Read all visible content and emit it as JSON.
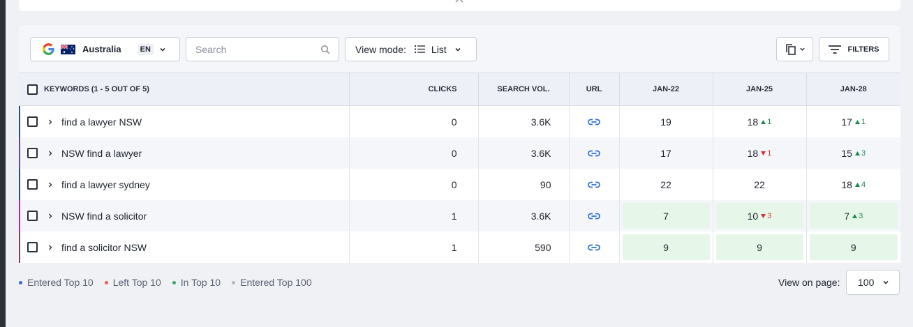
{
  "toolbar": {
    "country": "Australia",
    "language": "EN",
    "search_placeholder": "Search",
    "view_mode_label": "View mode:",
    "view_mode_value": "List",
    "filters_label": "FILTERS"
  },
  "table": {
    "headers": {
      "keywords": "KEYWORDS (1 - 5 OUT OF 5)",
      "clicks": "CLICKS",
      "search_vol": "SEARCH VOL.",
      "url": "URL",
      "d1": "JAN-22",
      "d2": "JAN-25",
      "d3": "JAN-28"
    },
    "rows": [
      {
        "keyword": "find a lawyer NSW",
        "clicks": "0",
        "volume": "3.6K",
        "d1": "19",
        "d2": "18",
        "d2_delta": "1",
        "d3": "17",
        "d3_delta": "1"
      },
      {
        "keyword": "NSW find a lawyer",
        "clicks": "0",
        "volume": "3.6K",
        "d1": "17",
        "d2": "18",
        "d2_delta": "1",
        "d3": "15",
        "d3_delta": "3"
      },
      {
        "keyword": "find a lawyer sydney",
        "clicks": "0",
        "volume": "90",
        "d1": "22",
        "d2": "22",
        "d2_delta": "",
        "d3": "18",
        "d3_delta": "4"
      },
      {
        "keyword": "NSW find a solicitor",
        "clicks": "1",
        "volume": "3.6K",
        "d1": "7",
        "d2": "10",
        "d2_delta": "3",
        "d3": "7",
        "d3_delta": "3"
      },
      {
        "keyword": "find a solicitor NSW",
        "clicks": "1",
        "volume": "590",
        "d1": "9",
        "d2": "9",
        "d2_delta": "",
        "d3": "9",
        "d3_delta": ""
      }
    ]
  },
  "legend": {
    "entered_top10": "Entered Top 10",
    "left_top10": "Left Top 10",
    "in_top10": "In Top 10",
    "entered_top100": "Entered Top 100"
  },
  "pagination": {
    "label": "View on page:",
    "value": "100"
  },
  "colors": {
    "row_bar_1": "#1f4e79",
    "row_bar_2": "#6b3fa0",
    "row_bar_3": "#1f4e79",
    "row_bar_4": "#d6189a",
    "row_bar_5": "#8b3a62",
    "up": "#1d8a4a",
    "down": "#d93036",
    "link": "#2d6fd6",
    "in_top10_bg": "#e6f7ea"
  }
}
